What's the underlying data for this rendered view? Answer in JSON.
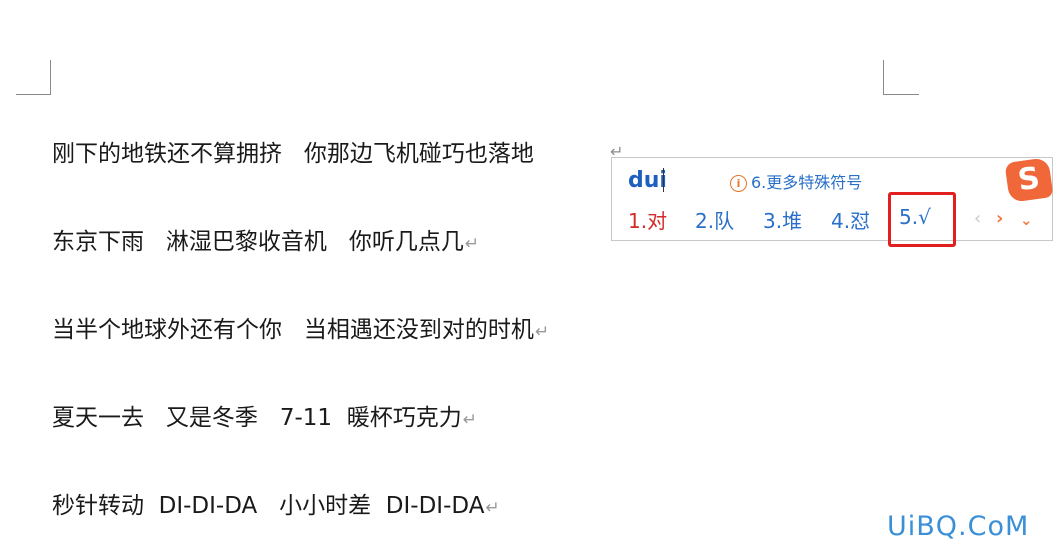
{
  "document": {
    "lines": [
      {
        "text": "刚下的地铁还不算拥挤   你那边飞机碰巧也落地",
        "pmark": ""
      },
      {
        "text": "东京下雨   淋湿巴黎收音机   你听几点几",
        "pmark": "↵"
      },
      {
        "text": "当半个地球外还有个你   当相遇还没到对的时机",
        "pmark": "↵"
      },
      {
        "text": "夏天一去   又是冬季   7-11  暖杯巧克力",
        "pmark": "↵"
      },
      {
        "text": "秒针转动  DI-DI-DA   小小时差  DI-DI-DA",
        "pmark": "↵"
      }
    ],
    "lone_pmark": "↵"
  },
  "ime": {
    "input": "dui",
    "hint_icon": "info-icon",
    "hint_icon_glyph": "i",
    "hint": "6.更多特殊符号",
    "candidates": [
      {
        "label": "1.对"
      },
      {
        "label": "2.队"
      },
      {
        "label": "3.堆"
      },
      {
        "label": "4.怼"
      },
      {
        "label": "5.√"
      }
    ],
    "logo_glyph": "S",
    "prev_glyph": "‹",
    "next_glyph": "›",
    "expand_glyph": "⌄",
    "accent": "#f07a3d",
    "candidate_color": "#2a70c8",
    "first_candidate_color": "#d42a2a"
  },
  "annotation": {
    "color": "#e31e1e"
  },
  "watermark": "UiBQ.CoM"
}
